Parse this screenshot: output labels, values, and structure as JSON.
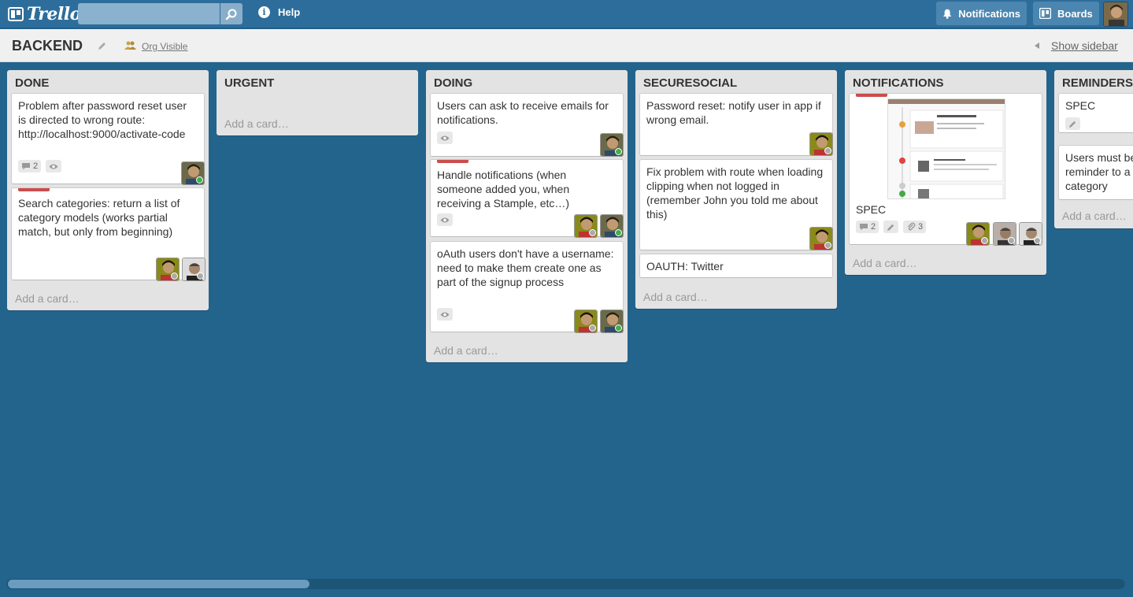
{
  "app": {
    "logo_text": "Trello",
    "help_label": "Help",
    "notifications_label": "Notifications",
    "boards_label": "Boards"
  },
  "board": {
    "title": "BACKEND",
    "visibility": "Org Visible",
    "sidebar_link": "Show sidebar"
  },
  "add_card_label": "Add a card…",
  "lists": [
    {
      "title": "DONE",
      "cards": [
        {
          "text": "Problem after password reset user is directed to wrong route: http://localhost:9000/activate-code",
          "comments": "2"
        },
        {
          "text": "Search categories: return a list of category models (works partial match, but only from beginning)",
          "label": "red"
        }
      ]
    },
    {
      "title": "URGENT",
      "cards": []
    },
    {
      "title": "DOING",
      "cards": [
        {
          "text": "Users can ask to receive emails for notifications."
        },
        {
          "text": "Handle notifications (when someone added you, when receiving a Stample, etc…)",
          "label": "red"
        },
        {
          "text": "oAuth users don't have a username: need to make them create one as part of the signup process"
        }
      ]
    },
    {
      "title": "SECURESOCIAL",
      "cards": [
        {
          "text": "Password reset: notify user in app if wrong email."
        },
        {
          "text": "Fix problem with route when loading clipping when not logged in (remember John you told me about this)"
        },
        {
          "text": "OAUTH: Twitter"
        }
      ]
    },
    {
      "title": "NOTIFICATIONS",
      "cards": [
        {
          "text": "SPEC",
          "comments": "2",
          "attachments": "3",
          "label": "red"
        }
      ]
    },
    {
      "title": "REMINDERS",
      "cards": [
        {
          "text": "SPEC"
        },
        {
          "text": "Users must be reminder to a category"
        }
      ]
    }
  ],
  "colors": {
    "board_bg": "#23648c",
    "header_bg": "#2d6d9b",
    "label_red": "#cb4d4d",
    "status_green": "#3cb34a"
  }
}
